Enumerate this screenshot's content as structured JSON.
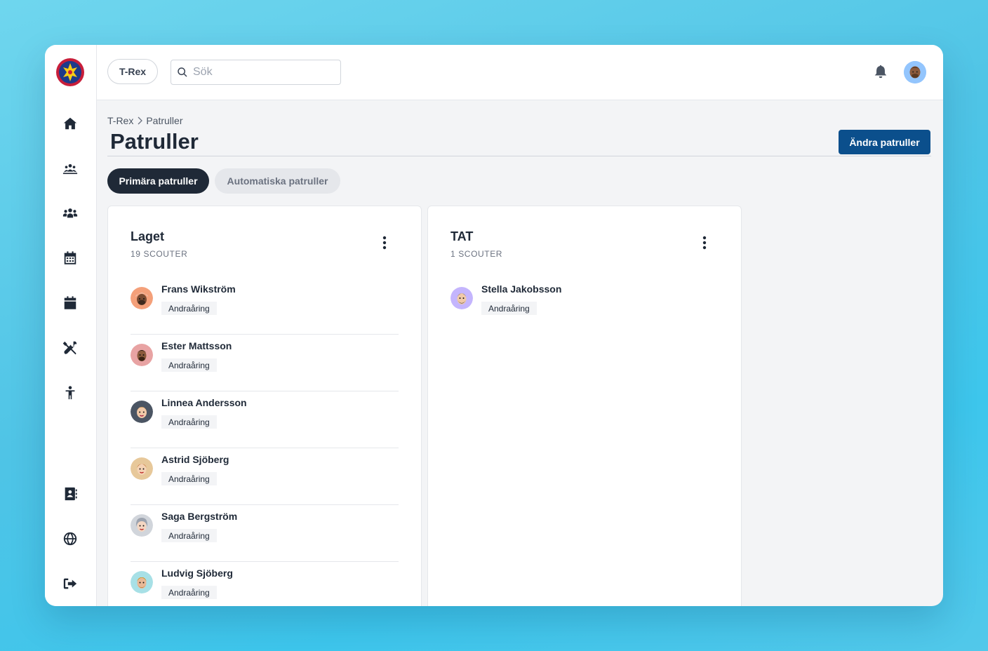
{
  "topbar": {
    "org_label": "T-Rex",
    "search_placeholder": "Sök"
  },
  "breadcrumb": {
    "root": "T-Rex",
    "current": "Patruller"
  },
  "page": {
    "title": "Patruller",
    "edit_button": "Ändra patruller"
  },
  "tabs": [
    {
      "label": "Primära patruller",
      "active": true
    },
    {
      "label": "Automatiska patruller",
      "active": false
    }
  ],
  "sidebar": {
    "items": [
      {
        "icon": "home-icon"
      },
      {
        "icon": "troop-icon"
      },
      {
        "icon": "users-icon"
      },
      {
        "icon": "calendar-grid-icon"
      },
      {
        "icon": "calendar-icon"
      },
      {
        "icon": "tools-icon"
      },
      {
        "icon": "child-icon"
      },
      {
        "icon": "contact-book-icon"
      },
      {
        "icon": "globe-icon"
      },
      {
        "icon": "logout-icon"
      }
    ]
  },
  "patrols": [
    {
      "name": "Laget",
      "count_label": "19 SCOUTER",
      "members": [
        {
          "name": "Frans Wikström",
          "badge": "Andraåring",
          "avatar_color": "#f4a07a"
        },
        {
          "name": "Ester Mattsson",
          "badge": "Andraåring",
          "avatar_color": "#e8a3a3"
        },
        {
          "name": "Linnea Andersson",
          "badge": "Andraåring",
          "avatar_color": "#4b5563"
        },
        {
          "name": "Astrid Sjöberg",
          "badge": "Andraåring",
          "avatar_color": "#e7c89a"
        },
        {
          "name": "Saga Bergström",
          "badge": "Andraåring",
          "avatar_color": "#d1d5db"
        },
        {
          "name": "Ludvig Sjöberg",
          "badge": "Andraåring",
          "avatar_color": "#a7e0e6"
        }
      ]
    },
    {
      "name": "TAT",
      "count_label": "1 SCOUTER",
      "members": [
        {
          "name": "Stella Jakobsson",
          "badge": "Andraåring",
          "avatar_color": "#c4b5fd"
        }
      ]
    }
  ],
  "colors": {
    "primary": "#0b4f8c",
    "dark": "#1f2937"
  }
}
